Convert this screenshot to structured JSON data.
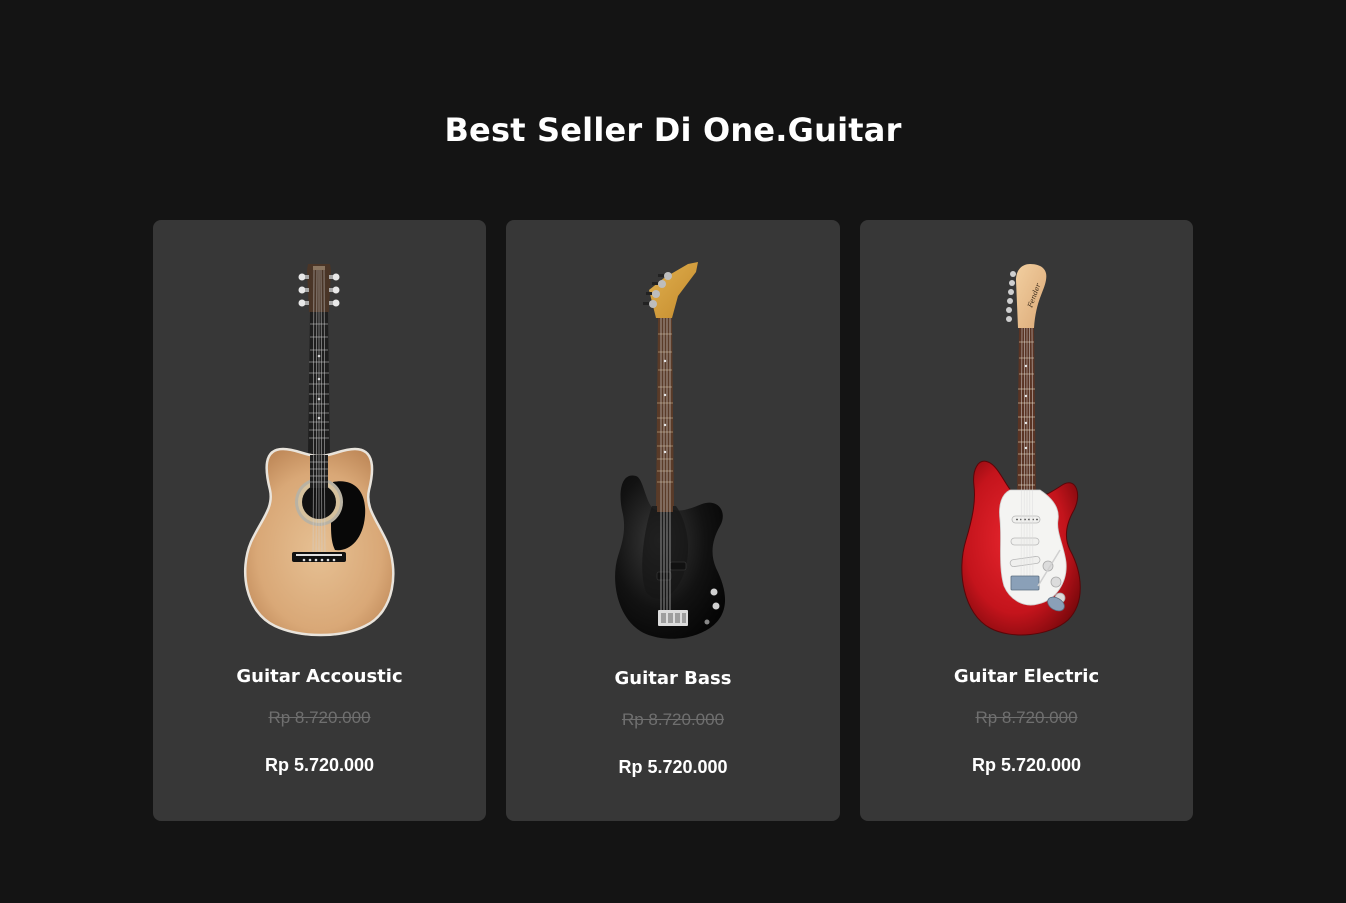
{
  "section": {
    "title": "Best Seller Di One.Guitar"
  },
  "products": [
    {
      "name": "Guitar Accoustic",
      "old_price": "Rp 8.720.000",
      "price": "Rp 5.720.000",
      "image": "acoustic-guitar-image"
    },
    {
      "name": "Guitar Bass",
      "old_price": "Rp 8.720.000",
      "price": "Rp 5.720.000",
      "image": "bass-guitar-image"
    },
    {
      "name": "Guitar Electric",
      "old_price": "Rp 8.720.000",
      "price": "Rp 5.720.000",
      "image": "electric-guitar-image"
    }
  ],
  "colors": {
    "background": "#141414",
    "card": "#373737",
    "text": "#ffffff",
    "strikethrough": "#6f6f6f"
  }
}
